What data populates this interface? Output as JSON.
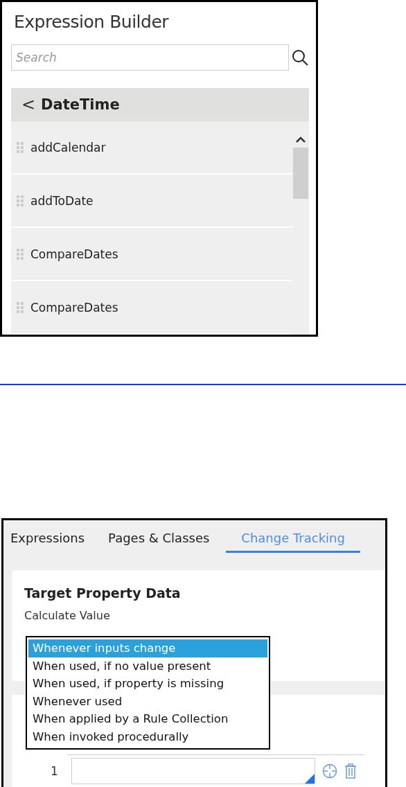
{
  "expression_builder": {
    "title": "Expression Builder",
    "search": {
      "placeholder": "Search"
    },
    "category": {
      "back": "<",
      "label": "DateTime"
    },
    "functions": [
      {
        "label": "addCalendar"
      },
      {
        "label": "addToDate"
      },
      {
        "label": "CompareDates"
      },
      {
        "label": "CompareDates"
      }
    ]
  },
  "rule_form": {
    "tabs": [
      {
        "label": "Expressions",
        "selected": false
      },
      {
        "label": "Pages & Classes",
        "selected": false
      },
      {
        "label": "Change Tracking",
        "selected": true
      }
    ],
    "section_title": "Target Property Data",
    "field_label": "Calculate Value",
    "options": [
      {
        "label": "Whenever inputs change",
        "selected": true
      },
      {
        "label": "When used, if no value present",
        "selected": false
      },
      {
        "label": "When used, if property is missing",
        "selected": false
      },
      {
        "label": "Whenever used",
        "selected": false
      },
      {
        "label": "When applied by a Rule Collection",
        "selected": false
      },
      {
        "label": "When invoked procedurally",
        "selected": false
      }
    ],
    "row": {
      "index": "1"
    }
  }
}
